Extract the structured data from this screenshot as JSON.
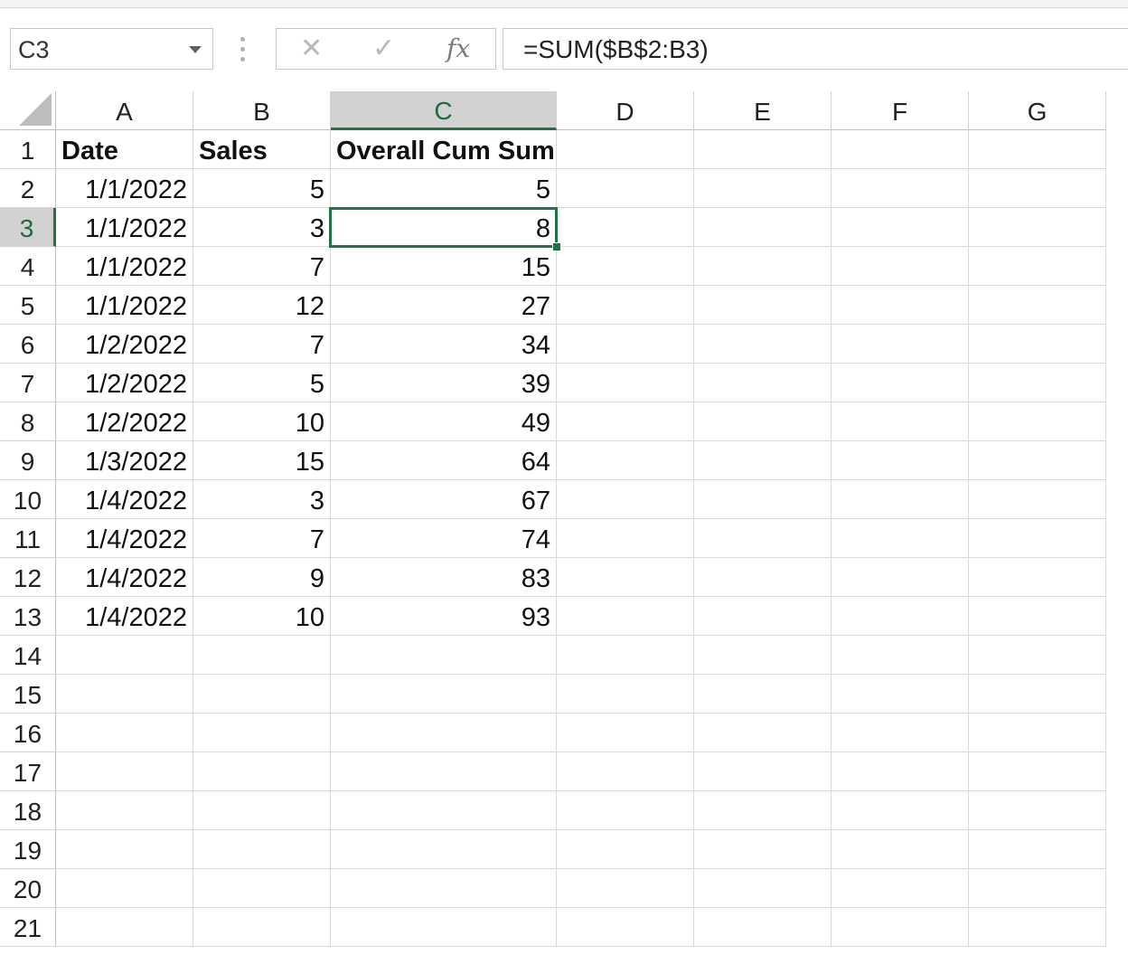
{
  "name_box": {
    "value": "C3"
  },
  "formula_bar": {
    "cancel_glyph": "✕",
    "enter_glyph": "✓",
    "function_glyph": "fx",
    "formula": "=SUM($B$2:B3)"
  },
  "columns": [
    "A",
    "B",
    "C",
    "D",
    "E",
    "F",
    "G"
  ],
  "rows": [
    "1",
    "2",
    "3",
    "4",
    "5",
    "6",
    "7",
    "8",
    "9",
    "10",
    "11",
    "12",
    "13",
    "14",
    "15",
    "16",
    "17",
    "18",
    "19",
    "20",
    "21"
  ],
  "selection": {
    "column": "C",
    "row": "3",
    "accent_color": "#217346"
  },
  "table": {
    "headers": [
      "Date",
      "Sales",
      "Overall Cum Sum"
    ],
    "rows": [
      [
        "1/1/2022",
        "5",
        "5"
      ],
      [
        "1/1/2022",
        "3",
        "8"
      ],
      [
        "1/1/2022",
        "7",
        "15"
      ],
      [
        "1/1/2022",
        "12",
        "27"
      ],
      [
        "1/2/2022",
        "7",
        "34"
      ],
      [
        "1/2/2022",
        "5",
        "39"
      ],
      [
        "1/2/2022",
        "10",
        "49"
      ],
      [
        "1/3/2022",
        "15",
        "64"
      ],
      [
        "1/4/2022",
        "3",
        "67"
      ],
      [
        "1/4/2022",
        "7",
        "74"
      ],
      [
        "1/4/2022",
        "9",
        "83"
      ],
      [
        "1/4/2022",
        "10",
        "93"
      ]
    ]
  },
  "icons": {
    "select_all": "select-all-triangle-icon",
    "name_box_dropdown": "chevron-down-icon",
    "grip": "vertical-grip-icon"
  }
}
